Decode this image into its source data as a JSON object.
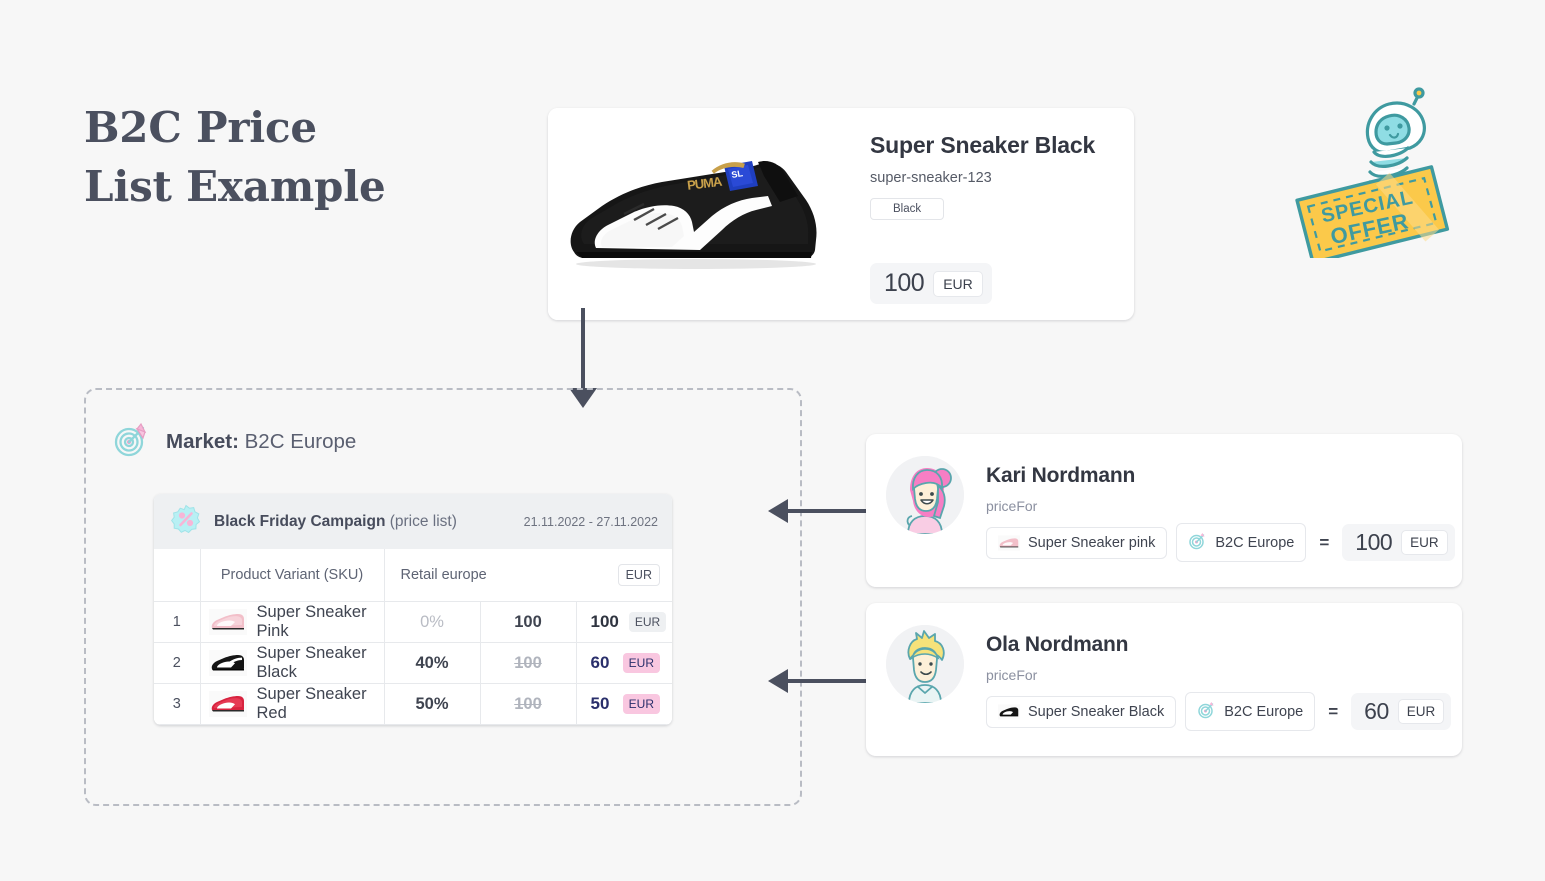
{
  "title": {
    "line1": "B2C Price",
    "line2": "List Example"
  },
  "product_card": {
    "name": "Super Sneaker Black",
    "sku": "super-sneaker-123",
    "variant_tag": "Black",
    "price": "100",
    "currency": "EUR",
    "image_icon": "black-sneaker-photo"
  },
  "special_offer": {
    "line1": "SPECIAL",
    "line2": "OFFER",
    "icon": "special-offer-stamp-robot"
  },
  "market": {
    "icon": "target-dart-icon",
    "label": "Market:",
    "value": "B2C Europe"
  },
  "pricelist": {
    "campaign_icon": "percent-badge-icon",
    "campaign_name": "Black Friday Campaign",
    "campaign_type": "(price list)",
    "dates": "21.11.2022 - 27.11.2022",
    "columns": {
      "num": "",
      "product": "Product Variant (SKU)",
      "retail": "Retail europe",
      "currency_badge": "EUR"
    },
    "rows": [
      {
        "num": "1",
        "thumb": "pink-sneaker-thumb",
        "product": "Super Sneaker Pink",
        "discount": "0%",
        "discount_muted": true,
        "original": "100",
        "original_struck": false,
        "final": "100",
        "currency": "EUR",
        "highlight": false
      },
      {
        "num": "2",
        "thumb": "black-sneaker-thumb",
        "product": "Super Sneaker Black",
        "discount": "40%",
        "discount_muted": false,
        "original": "100",
        "original_struck": true,
        "final": "60",
        "currency": "EUR",
        "highlight": true
      },
      {
        "num": "3",
        "thumb": "red-sneaker-thumb",
        "product": "Super Sneaker Red",
        "discount": "50%",
        "discount_muted": false,
        "original": "100",
        "original_struck": true,
        "final": "50",
        "currency": "EUR",
        "highlight": true
      }
    ]
  },
  "customers": [
    {
      "avatar": "pink-hair-woman-avatar",
      "name": "Kari Nordmann",
      "pricefor_label": "priceFor",
      "product_chip": "Super Sneaker pink",
      "product_chip_icon": "pink-sneaker-thumb",
      "market_chip": "B2C Europe",
      "market_chip_icon": "target-dart-icon",
      "equals": "=",
      "price": "100",
      "currency": "EUR"
    },
    {
      "avatar": "blond-hair-man-avatar",
      "name": "Ola Nordmann",
      "pricefor_label": "priceFor",
      "product_chip": "Super Sneaker Black",
      "product_chip_icon": "black-sneaker-thumb",
      "market_chip": "B2C Europe",
      "market_chip_icon": "target-dart-icon",
      "equals": "=",
      "price": "60",
      "currency": "EUR"
    }
  ],
  "colors": {
    "background": "#f7f7f7",
    "title": "#4b505f",
    "highlight_pink": "#fbd5e8",
    "highlight_text": "#2a2f6b",
    "accent_teal": "#7fd4d8",
    "accent_pink": "#f7a8d0",
    "offer_yellow": "#fbc94a",
    "arrow": "#4b505f"
  }
}
